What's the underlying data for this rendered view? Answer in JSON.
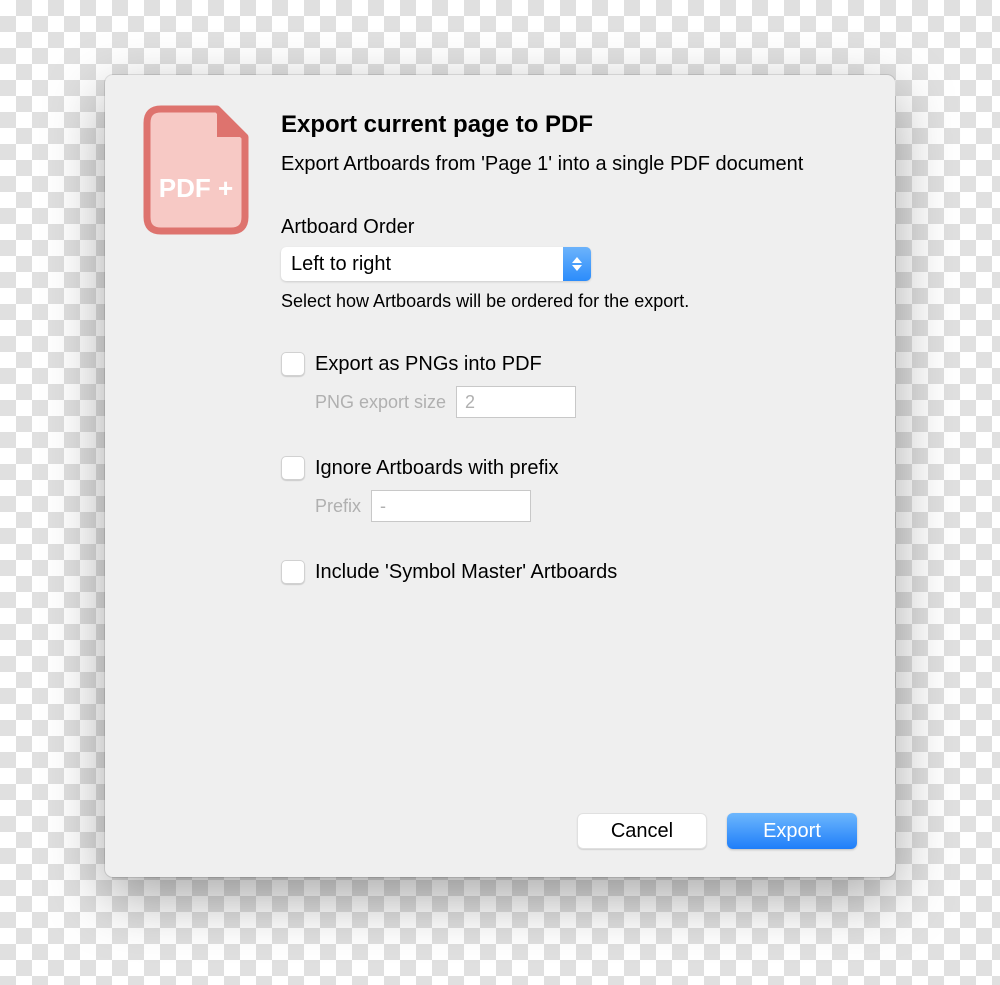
{
  "dialog": {
    "title": "Export current page to PDF",
    "subtitle": "Export Artboards from 'Page 1' into a single PDF document",
    "icon_label": "PDF +",
    "artboard_order": {
      "label": "Artboard Order",
      "value": "Left to right",
      "help": "Select how Artboards will be ordered for the export."
    },
    "export_png": {
      "label": "Export as PNGs into PDF",
      "checked": false,
      "size_label": "PNG export size",
      "size_value": "2"
    },
    "ignore_prefix": {
      "label": "Ignore Artboards with prefix",
      "checked": false,
      "prefix_label": "Prefix",
      "prefix_value": "-"
    },
    "include_symbol": {
      "label": "Include 'Symbol Master' Artboards",
      "checked": false
    },
    "buttons": {
      "cancel": "Cancel",
      "export": "Export"
    }
  }
}
